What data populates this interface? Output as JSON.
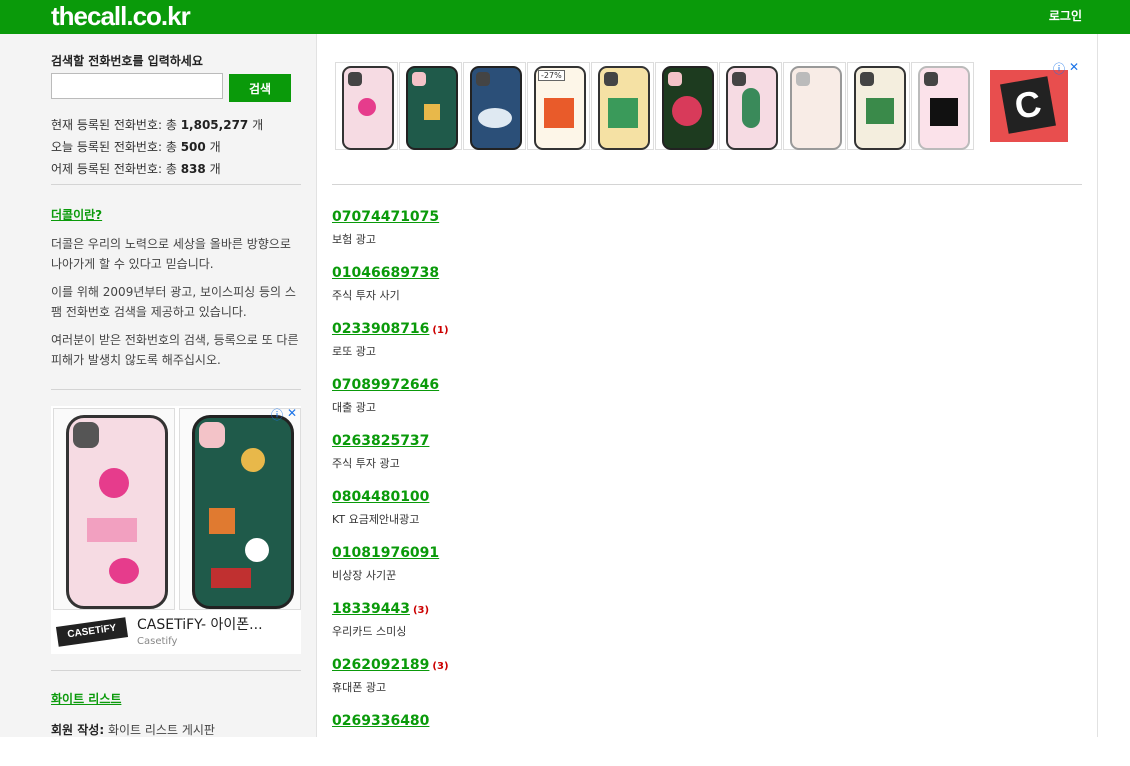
{
  "header": {
    "logo": "thecall.co.kr",
    "login": "로그인"
  },
  "sidebar": {
    "search_label": "검색할 전화번호를 입력하세요",
    "search_input_value": "",
    "search_button": "검색",
    "stats": [
      {
        "prefix": "현재 등록된 전화번호: 총 ",
        "value": "1,805,277",
        "suffix": " 개"
      },
      {
        "prefix": "오늘 등록된 전화번호: 총 ",
        "value": "500",
        "suffix": " 개"
      },
      {
        "prefix": "어제 등록된 전화번호: 총 ",
        "value": "838",
        "suffix": " 개"
      }
    ],
    "about_link": "더콜이란?",
    "paragraphs": [
      "더콜은 우리의 노력으로 세상을 올바른 방향으로 나아가게 할 수 있다고 믿습니다.",
      "이를 위해 2009년부터 광고, 보이스피싱 등의 스팸 전화번호 검색을 제공하고 있습니다.",
      "여러분이 받은 전화번호의 검색, 등록으로 또 다른 피해가 발생치 않도록 해주십시오."
    ],
    "ad": {
      "logo": "CASETiFY",
      "title": "CASETiFY- 아이폰...",
      "subtitle": "Casetify",
      "info": "ⓘ",
      "close": "✕"
    },
    "whitelist_link": "화이트 리스트",
    "member_label": "회원 작성:",
    "member_value": " 화이트 리스트 게시판"
  },
  "top_ad": {
    "info": "ⓘ",
    "close": "✕",
    "discount": "-27%",
    "brand_letter": "C"
  },
  "entries": [
    {
      "number": "07074471075",
      "count": "",
      "desc": "보험 광고"
    },
    {
      "number": "01046689738",
      "count": "",
      "desc": "주식 투자 사기"
    },
    {
      "number": "0233908716",
      "count": "(1)",
      "desc": "로또 광고"
    },
    {
      "number": "07089972646",
      "count": "",
      "desc": "대출 광고"
    },
    {
      "number": "0263825737",
      "count": "",
      "desc": "주식 투자 광고"
    },
    {
      "number": "0804480100",
      "count": "",
      "desc": "KT 요금제안내광고"
    },
    {
      "number": "01081976091",
      "count": "",
      "desc": "비상장 사기꾼"
    },
    {
      "number": "18339443",
      "count": "(3)",
      "desc": "우리카드 스미싱"
    },
    {
      "number": "0262092189",
      "count": "(3)",
      "desc": "휴대폰 광고"
    },
    {
      "number": "0269336480",
      "count": "",
      "desc": ""
    }
  ],
  "colors": {
    "brand": "#0a9a0a",
    "count": "#cc0000"
  }
}
